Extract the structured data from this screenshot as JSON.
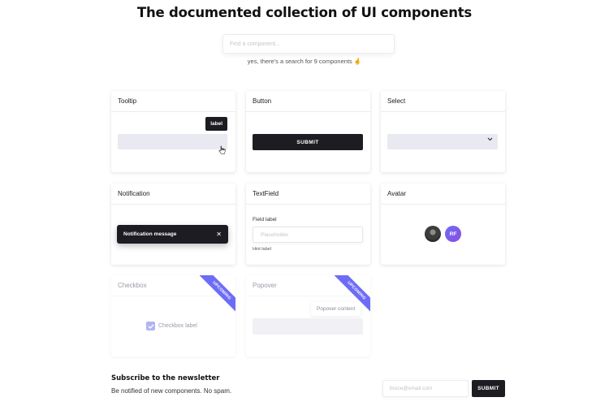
{
  "header": {
    "title": "The documented collection of UI components",
    "search_placeholder": "Find a component...",
    "search_note": "yes, there's a search for 9 components 🤞"
  },
  "cards": {
    "tooltip": {
      "title": "Tooltip",
      "label": "label"
    },
    "button": {
      "title": "Button",
      "label": "SUBMIT"
    },
    "select": {
      "title": "Select",
      "chevron_icon": "chevron-down-icon"
    },
    "notification": {
      "title": "Notification",
      "message": "Notification message",
      "close_glyph": "✕"
    },
    "textfield": {
      "title": "TextField",
      "field_label": "Field label",
      "placeholder": "Placeholder",
      "hint": "Hint label"
    },
    "avatar": {
      "title": "Avatar",
      "initials": "RF"
    },
    "checkbox": {
      "title": "Checkbox",
      "label": "Checkbox label",
      "badge": "UPCOMING",
      "checked": true
    },
    "popover": {
      "title": "Popover",
      "content": "Popover content",
      "badge": "UPCOMING"
    }
  },
  "newsletter": {
    "title": "Subscribe to the newsletter",
    "subtitle": "Be notified of new components. No spam.",
    "email_placeholder": "bruce@email.com",
    "submit_label": "SUBMIT"
  },
  "colors": {
    "dark": "#1c1c22",
    "accent": "#6d6cf6",
    "field_bg": "#e9e9f2"
  }
}
